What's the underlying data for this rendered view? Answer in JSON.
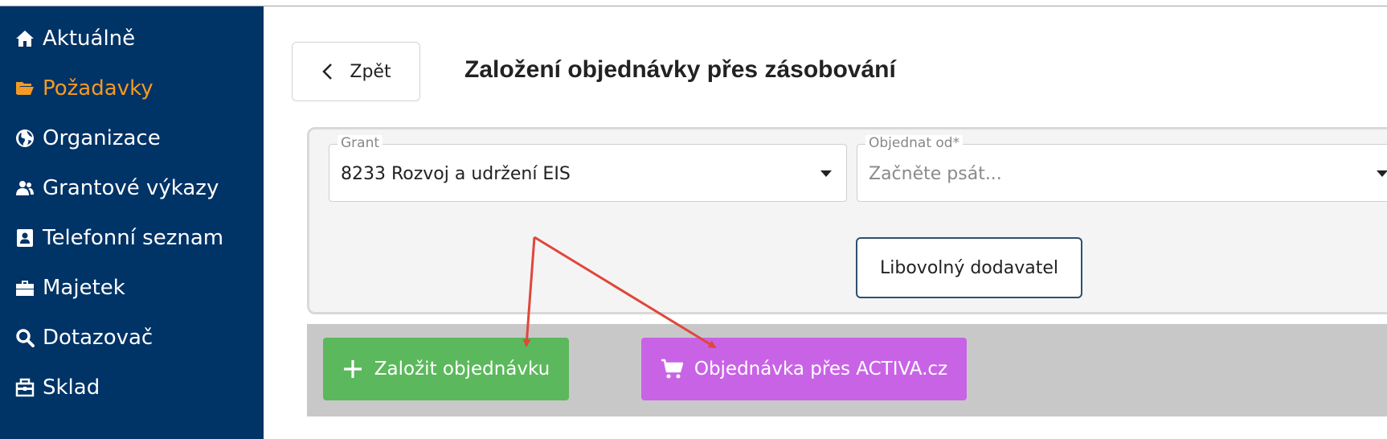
{
  "sidebar": {
    "items": [
      {
        "label": "Aktuálně",
        "icon": "home-icon"
      },
      {
        "label": "Požadavky",
        "icon": "folder-open-icon",
        "active": true
      },
      {
        "label": "Organizace",
        "icon": "globe-icon"
      },
      {
        "label": "Grantové výkazy",
        "icon": "users-icon"
      },
      {
        "label": "Telefonní seznam",
        "icon": "address-book-icon"
      },
      {
        "label": "Majetek",
        "icon": "toolbox-icon"
      },
      {
        "label": "Dotazovač",
        "icon": "search-icon"
      },
      {
        "label": "Sklad",
        "icon": "warehouse-icon"
      }
    ]
  },
  "header": {
    "back_label": "Zpět",
    "title": "Založení objednávky přes zásobování"
  },
  "form": {
    "grant": {
      "label": "Grant",
      "value": "8233 Rozvoj a udržení EIS"
    },
    "order_from": {
      "label": "Objednat od*",
      "placeholder": "Začněte psát..."
    },
    "any_supplier_label": "Libovolný dodavatel"
  },
  "actions": {
    "create_label": "Založit objednávku",
    "activa_label": "Objednávka přes ACTIVA.cz"
  },
  "colors": {
    "sidebar_bg": "#003366",
    "active_item": "#f59a23",
    "create_button": "#5cb85c",
    "activa_button": "#c963e6",
    "annotation_arrow": "#e0463a"
  }
}
